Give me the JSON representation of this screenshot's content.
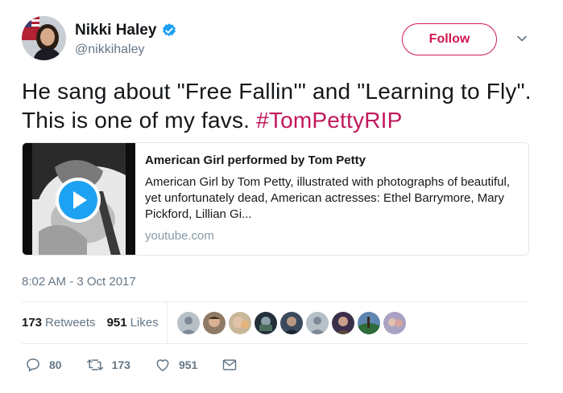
{
  "author": {
    "display_name": "Nikki Haley",
    "handle": "@nikkihaley",
    "verified": true,
    "avatar_icon": "profile-photo"
  },
  "follow_label": "Follow",
  "tweet": {
    "text_before_hashtag": "He sang about \"Free Fallin'\" and \"Learning to Fly\". This is one of my favs. ",
    "hashtag": "#TomPettyRIP"
  },
  "card": {
    "title": "American Girl performed by Tom Petty",
    "description": "American Girl by Tom Petty, illustrated with photographs of beautiful, yet unfortunately dead, American actresses: Ethel Barrymore, Mary Pickford, Lillian Gi...",
    "domain": "youtube.com"
  },
  "timestamp": "8:02 AM - 3 Oct 2017",
  "stats": {
    "retweets_count": "173",
    "retweets_label": "Retweets",
    "likes_count": "951",
    "likes_label": "Likes"
  },
  "actions": {
    "reply_count": "80",
    "retweet_count": "173",
    "like_count": "951"
  },
  "colors": {
    "accent": "#d0174f",
    "hashtag": "#c2185b",
    "verified": "#1da1f2",
    "muted": "#657786"
  }
}
